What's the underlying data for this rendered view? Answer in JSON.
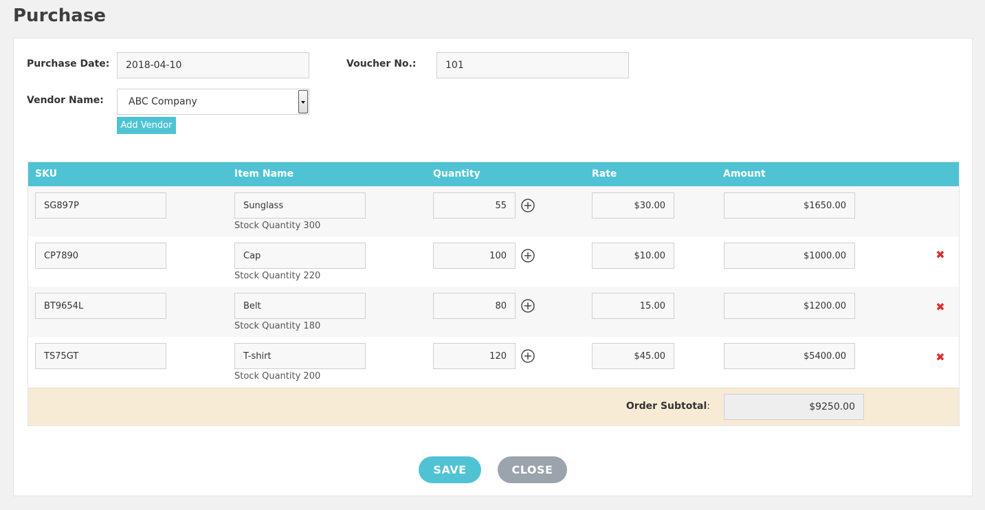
{
  "page": {
    "title": "Purchase"
  },
  "form": {
    "purchase_date_label": "Purchase Date:",
    "purchase_date_value": "2018-04-10",
    "voucher_label": "Voucher No.:",
    "voucher_value": "101",
    "vendor_label": "Vendor Name:",
    "vendor_value": "ABC Company",
    "add_vendor_label": "Add Vendor"
  },
  "table": {
    "headers": {
      "sku": "SKU",
      "item": "Item Name",
      "quantity": "Quantity",
      "rate": "Rate",
      "amount": "Amount"
    },
    "rows": [
      {
        "sku": "SG897P",
        "item": "Sunglass",
        "stock": "Stock Quantity 300",
        "qty": "55",
        "rate": "$30.00",
        "amount": "$1650.00"
      },
      {
        "sku": "CP7890",
        "item": "Cap",
        "stock": "Stock Quantity 220",
        "qty": "100",
        "rate": "$10.00",
        "amount": "$1000.00"
      },
      {
        "sku": "BT9654L",
        "item": "Belt",
        "stock": "Stock Quantity 180",
        "qty": "80",
        "rate": "15.00",
        "amount": "$1200.00"
      },
      {
        "sku": "TS75GT",
        "item": "T-shirt",
        "stock": "Stock Quantity 200",
        "qty": "120",
        "rate": "$45.00",
        "amount": "$5400.00"
      }
    ],
    "subtotal_label": "Order Subtotal",
    "subtotal_colon": ":",
    "subtotal_value": "$9250.00"
  },
  "actions": {
    "save_label": "SAVE",
    "close_label": "CLOSE"
  },
  "colors": {
    "accent": "#4fc3d4",
    "delete": "#d9302c",
    "subtotal_bg": "#f8ebd6",
    "close_btn": "#9ba3ad"
  },
  "icons": {
    "add": "plus-circle-icon",
    "remove": "delete-x-icon",
    "dropdown": "chevron-down-icon"
  }
}
